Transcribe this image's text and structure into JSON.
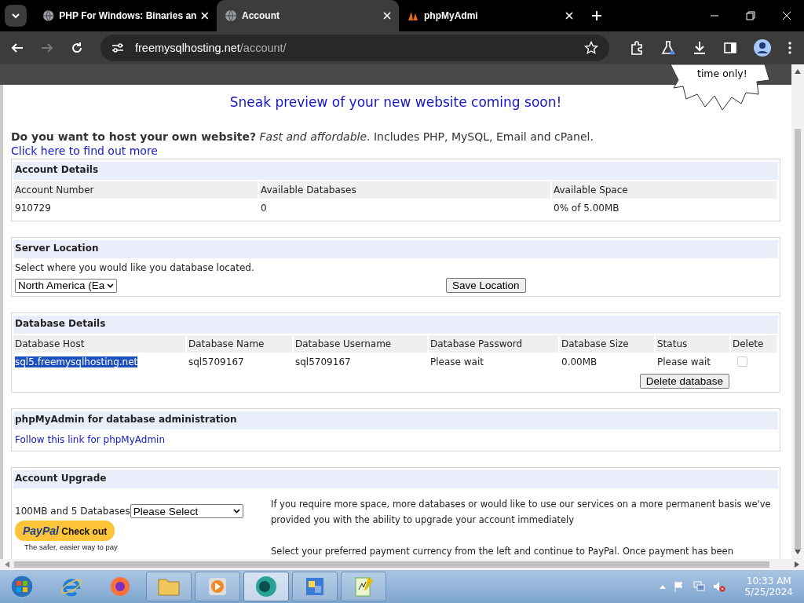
{
  "browser": {
    "tabs": [
      {
        "title": "PHP For Windows: Binaries an",
        "selected": false,
        "kind": "globe"
      },
      {
        "title": "Account",
        "selected": true,
        "kind": "globe"
      },
      {
        "title": "phpMyAdmi",
        "selected": false,
        "kind": "sail"
      }
    ],
    "url": {
      "host": "freemysqlhosting.net",
      "path": "/account/"
    }
  },
  "page": {
    "badge": "time only!",
    "headline": "Sneak preview of your new website coming soon!",
    "promo": "**Do you want to host your own website?** *Fast and affordable*. Includes PHP, MySQL, Email and cPanel.",
    "promo_link": "Click here to find out more",
    "account_details": {
      "title": "Account Details",
      "columns": [
        "Account Number",
        "Available Databases",
        "Available Space"
      ],
      "values": [
        "910729",
        "0",
        "0% of 5.00MB"
      ]
    },
    "server_location": {
      "title": "Server Location",
      "hint": "Select where you would like you database located.",
      "select": "North America (Ea",
      "button": "Save Location"
    },
    "database_details": {
      "title": "Database Details",
      "columns": [
        "Database Host",
        "Database Name",
        "Database Username",
        "Database Password",
        "Database Size",
        "Status",
        "Delete"
      ],
      "row": {
        "host": "sql5.freemysqlhosting.net",
        "host_selected": true,
        "name": "sql5709167",
        "username": "sql5709167",
        "password": "Please wait",
        "size": "0.00MB",
        "status": "Please wait",
        "checked": false
      },
      "button": "Delete database"
    },
    "phpmyadmin": {
      "title": "phpMyAdmin for database administration",
      "link": "Follow this link for phpMyAdmin"
    },
    "upgrade": {
      "title": "Account Upgrade",
      "plan": "100MB and 5 Databases",
      "select": "Please Select",
      "paypal": {
        "brand": "PayPal",
        "action": "Check out",
        "caption": "The safer, easier way to pay"
      },
      "paragraphs": [
        "If you require more space, more databases or would like to use our services on a more permanent basis we've provided you with the ability to upgrade your account immediately",
        "Select your preferred payment currency from the left and continue to PayPal. Once payment has been"
      ]
    }
  },
  "taskbar": {
    "apps": [
      {
        "kind": "ie",
        "selected": false
      },
      {
        "kind": "firefox",
        "selected": false
      },
      {
        "kind": "folder",
        "selected": false
      },
      {
        "kind": "media",
        "selected": false
      },
      {
        "kind": "chrome",
        "selected": true
      },
      {
        "kind": "control",
        "selected": false
      },
      {
        "kind": "notepad",
        "selected": false
      }
    ],
    "time": "10:33 AM",
    "date": "5/25/2024"
  }
}
